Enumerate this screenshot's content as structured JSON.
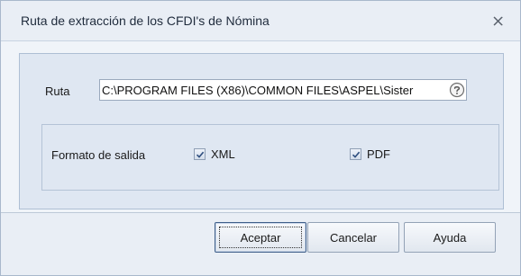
{
  "window": {
    "title": "Ruta de extracción de los CFDI's de Nómina"
  },
  "route": {
    "label": "Ruta",
    "value": "C:\\PROGRAM FILES (X86)\\COMMON FILES\\ASPEL\\Sister"
  },
  "format": {
    "label": "Formato de salida",
    "xml": {
      "label": "XML",
      "checked": true
    },
    "pdf": {
      "label": "PDF",
      "checked": true
    }
  },
  "buttons": {
    "ok": "Aceptar",
    "cancel": "Cancelar",
    "help": "Ayuda"
  },
  "icons": {
    "close": "close-icon",
    "help": "help-icon",
    "check": "checkmark-icon"
  }
}
